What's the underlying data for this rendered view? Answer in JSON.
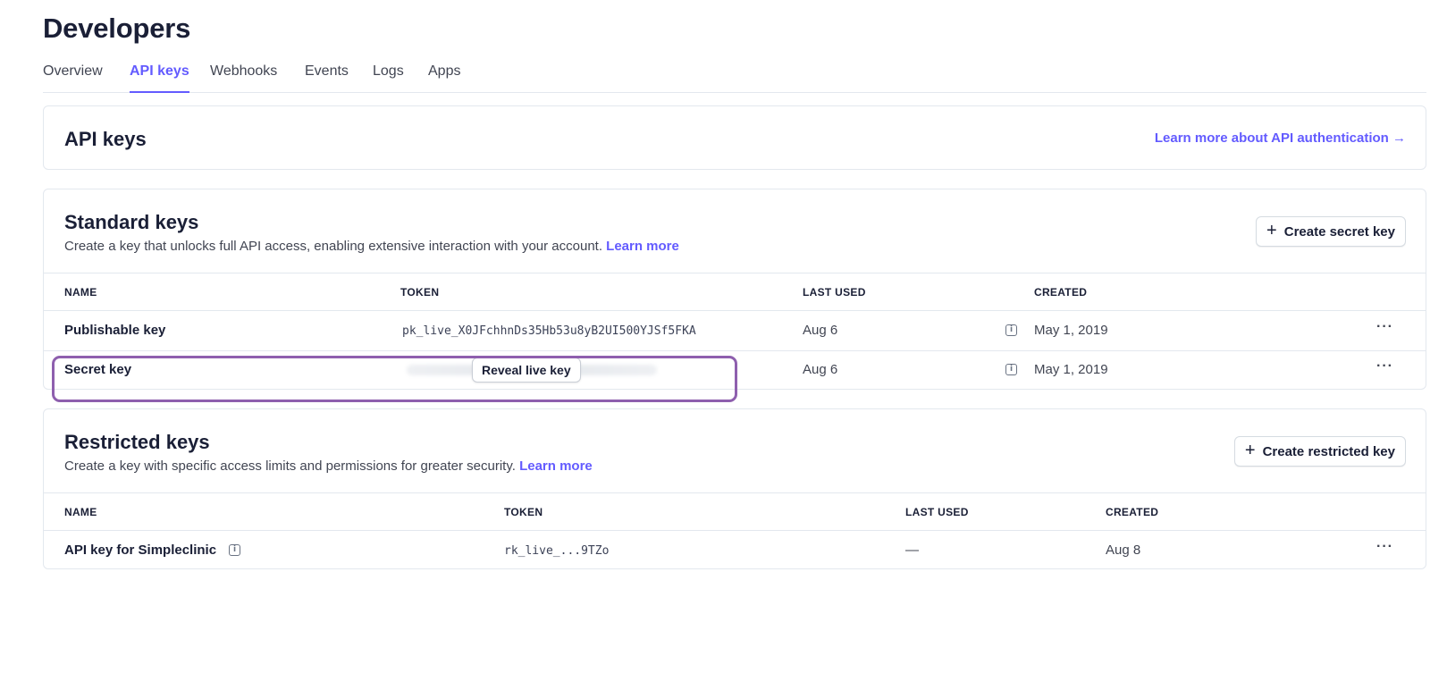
{
  "page": {
    "title": "Developers"
  },
  "tabs": [
    {
      "label": "Overview",
      "active": false
    },
    {
      "label": "API keys",
      "active": true
    },
    {
      "label": "Webhooks",
      "active": false
    },
    {
      "label": "Events",
      "active": false
    },
    {
      "label": "Logs",
      "active": false
    },
    {
      "label": "Apps",
      "active": false
    }
  ],
  "api_keys_card": {
    "title": "API keys",
    "learn_more_link": "Learn more about API authentication →"
  },
  "standard_keys": {
    "title": "Standard keys",
    "description": "Create a key that unlocks full API access, enabling extensive interaction with your account.",
    "learn_more": "Learn more",
    "create_button": "Create secret key",
    "columns": [
      "NAME",
      "TOKEN",
      "LAST USED",
      "CREATED"
    ],
    "rows": [
      {
        "name": "Publishable key",
        "token": "pk_live_X0JFchhnDs35Hb53u8yB2UI500YJSf5FKA",
        "last_used": "Aug 6",
        "created": "May 1, 2019",
        "more": "···"
      },
      {
        "name": "Secret key",
        "token_action": "Reveal live key",
        "last_used": "Aug 6",
        "created": "May 1, 2019",
        "more": "···"
      }
    ]
  },
  "restricted_keys": {
    "title": "Restricted keys",
    "description": "Create a key with specific access limits and permissions for greater security.",
    "learn_more": "Learn more",
    "create_button": "Create restricted key",
    "columns": [
      "NAME",
      "TOKEN",
      "LAST USED",
      "CREATED"
    ],
    "rows": [
      {
        "name": "API key for Simpleclinic",
        "token": "rk_live_...9TZo",
        "last_used": "—",
        "created": "Aug 8",
        "more": "···"
      }
    ]
  },
  "colors": {
    "accent": "#635bff",
    "highlight": "#8e5fae",
    "border": "#e3e8ee"
  },
  "icons": {
    "info": "info-icon",
    "plus": "plus-icon",
    "more": "more-horizontal-icon"
  }
}
